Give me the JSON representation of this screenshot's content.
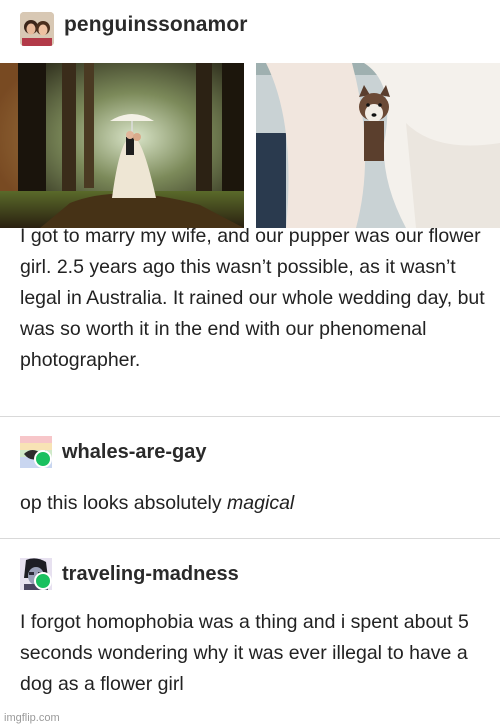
{
  "op": {
    "username": "penguinssonamor",
    "body": "I got to marry my wife, and our pupper was our flower girl. 2.5 years ago this wasn’t possible, as it wasn’t legal in Australia. It rained our whole wedding day, but was so worth it in the end with our phenomenal photographer."
  },
  "reblogs": [
    {
      "username": "whales-are-gay",
      "text_before": "op this looks absolutely ",
      "text_emphasis": "magical"
    },
    {
      "username": "traveling-madness",
      "text": "I forgot homophobia was a thing and i spent about 5 seconds wondering why it was ever illegal to have a dog as a flower girl"
    }
  ],
  "watermark": "imgflip.com",
  "colors": {
    "reblog_badge": "#19c05f",
    "divider": "#d9d9d9"
  }
}
